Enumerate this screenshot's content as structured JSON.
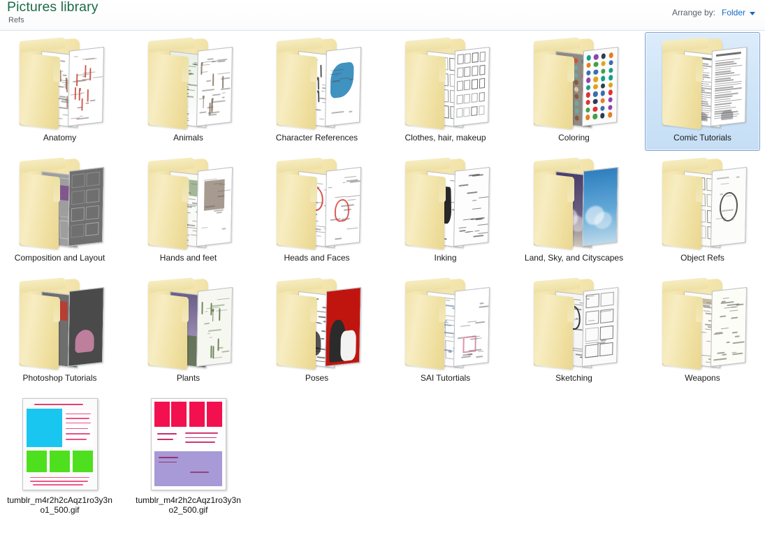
{
  "header": {
    "library_title": "Pictures library",
    "subtitle": "Refs",
    "arrange_label": "Arrange by:",
    "arrange_value": "Folder",
    "caret_icon": "chevron-down-icon",
    "title_color": "#1b6b47",
    "link_color": "#1569c7"
  },
  "view": {
    "background_color": "#ffffff",
    "selection_fill": "#cfe4f7",
    "selection_border": "#7da2ce",
    "folder_color": "#f0e0a2",
    "columns": 6
  },
  "items": [
    {
      "name": "Anatomy",
      "type": "folder",
      "selected": false,
      "icon": "folder-icon"
    },
    {
      "name": "Animals",
      "type": "folder",
      "selected": false,
      "icon": "folder-icon"
    },
    {
      "name": "Character References",
      "type": "folder",
      "selected": false,
      "icon": "folder-icon"
    },
    {
      "name": "Clothes, hair, makeup",
      "type": "folder",
      "selected": false,
      "icon": "folder-icon"
    },
    {
      "name": "Coloring",
      "type": "folder",
      "selected": false,
      "icon": "folder-icon"
    },
    {
      "name": "Comic Tutorials",
      "type": "folder",
      "selected": true,
      "icon": "folder-icon"
    },
    {
      "name": "Composition and Layout",
      "type": "folder",
      "selected": false,
      "icon": "folder-icon"
    },
    {
      "name": "Hands and feet",
      "type": "folder",
      "selected": false,
      "icon": "folder-icon"
    },
    {
      "name": "Heads and Faces",
      "type": "folder",
      "selected": false,
      "icon": "folder-icon"
    },
    {
      "name": "Inking",
      "type": "folder",
      "selected": false,
      "icon": "folder-icon"
    },
    {
      "name": "Land, Sky, and Cityscapes",
      "type": "folder",
      "selected": false,
      "icon": "folder-icon"
    },
    {
      "name": "Object Refs",
      "type": "folder",
      "selected": false,
      "icon": "folder-icon"
    },
    {
      "name": "Photoshop Tutorials",
      "type": "folder",
      "selected": false,
      "icon": "folder-icon"
    },
    {
      "name": "Plants",
      "type": "folder",
      "selected": false,
      "icon": "folder-icon"
    },
    {
      "name": "Poses",
      "type": "folder",
      "selected": false,
      "icon": "folder-icon"
    },
    {
      "name": "SAI Tutortials",
      "type": "folder",
      "selected": false,
      "icon": "folder-icon"
    },
    {
      "name": "Sketching",
      "type": "folder",
      "selected": false,
      "icon": "folder-icon"
    },
    {
      "name": "Weapons",
      "type": "folder",
      "selected": false,
      "icon": "folder-icon"
    },
    {
      "name": "tumblr_m4r2h2cAqz1ro3y3no1_500.gif",
      "type": "file",
      "selected": false,
      "icon": "image-file-icon"
    },
    {
      "name": "tumblr_m4r2h2cAqz1ro3y3no2_500.gif",
      "type": "file",
      "selected": false,
      "icon": "image-file-icon"
    }
  ]
}
